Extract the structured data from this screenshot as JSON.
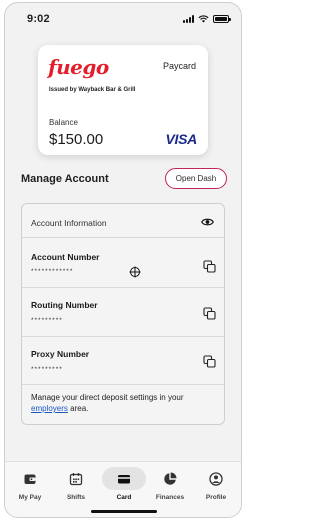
{
  "status_bar": {
    "time": "9:02"
  },
  "card": {
    "brand": "fuego",
    "type_label": "Paycard",
    "issuer": "Issued by Wayback Bar & Grill",
    "balance_label": "Balance",
    "balance": "$150.00",
    "network": "VISA",
    "brand_color": "#e41d2a"
  },
  "manage": {
    "title": "Manage Account",
    "open_dash_label": "Open Dash",
    "accent_color": "#c0245b"
  },
  "account_info": {
    "header": "Account Information",
    "rows": [
      {
        "label": "Account Number",
        "masked": "************",
        "icon": "copy-icon"
      },
      {
        "label": "Routing Number",
        "masked": "*********",
        "icon": "copy-icon"
      },
      {
        "label": "Proxy Number",
        "masked": "*********",
        "icon": "copy-icon"
      }
    ],
    "note_prefix": "Manage your direct deposit settings in your ",
    "note_link": "employers",
    "note_suffix": " area."
  },
  "bottom_nav": {
    "items": [
      {
        "label": "My Pay",
        "icon": "wallet-icon",
        "active": false
      },
      {
        "label": "Shifts",
        "icon": "calendar-icon",
        "active": false
      },
      {
        "label": "Card",
        "icon": "card-icon",
        "active": true
      },
      {
        "label": "Finances",
        "icon": "pie-chart-icon",
        "active": false
      },
      {
        "label": "Profile",
        "icon": "profile-icon",
        "active": false
      }
    ]
  }
}
